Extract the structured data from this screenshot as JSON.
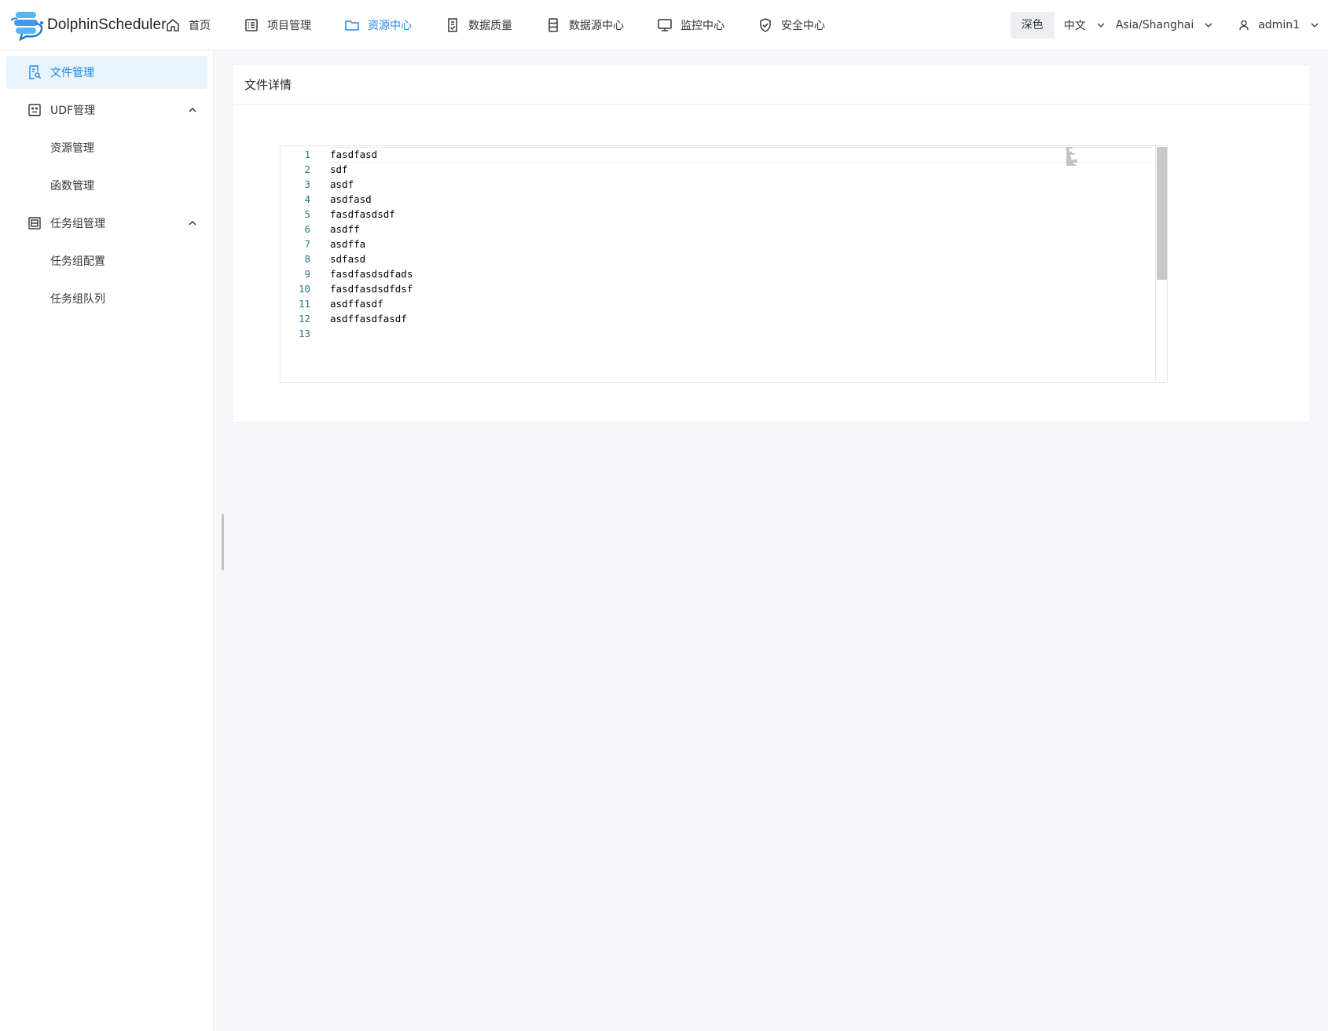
{
  "app": {
    "name": "DolphinScheduler"
  },
  "nav": {
    "items": [
      {
        "label": "首页",
        "icon": "home-icon"
      },
      {
        "label": "项目管理",
        "icon": "project-list-icon"
      },
      {
        "label": "资源中心",
        "icon": "folder-icon",
        "active": true
      },
      {
        "label": "数据质量",
        "icon": "document-check-icon"
      },
      {
        "label": "数据源中心",
        "icon": "database-icon"
      },
      {
        "label": "监控中心",
        "icon": "monitor-icon"
      },
      {
        "label": "安全中心",
        "icon": "shield-check-icon"
      }
    ]
  },
  "header_tools": {
    "theme_label": "深色",
    "language": "中文",
    "timezone": "Asia/Shanghai",
    "user": "admin1"
  },
  "sidebar": {
    "items": [
      {
        "label": "文件管理",
        "icon": "file-search-icon",
        "active": true
      },
      {
        "label": "UDF管理",
        "icon": "udf-icon",
        "expanded": true
      },
      {
        "label": "资源管理"
      },
      {
        "label": "函数管理"
      },
      {
        "label": "任务组管理",
        "icon": "task-group-icon",
        "expanded": true
      },
      {
        "label": "任务组配置"
      },
      {
        "label": "任务组队列"
      }
    ]
  },
  "card": {
    "title": "文件详情"
  },
  "editor": {
    "lines": [
      "fasdfasd",
      "sdf",
      "asdf",
      "asdfasd",
      "fasdfasdsdf",
      "asdff",
      "asdffa",
      "sdfasd",
      "fasdfasdsdfads",
      "fasdfasdsdfdsf",
      "asdffasdf",
      "asdffasdfasdf",
      ""
    ],
    "line_numbers": [
      "1",
      "2",
      "3",
      "4",
      "5",
      "6",
      "7",
      "8",
      "9",
      "10",
      "11",
      "12",
      "13"
    ]
  },
  "colors": {
    "accent": "#1e88e5",
    "active_bg": "#e8f3fd",
    "line_number": "#237893",
    "page_bg": "#f7f7fb"
  }
}
